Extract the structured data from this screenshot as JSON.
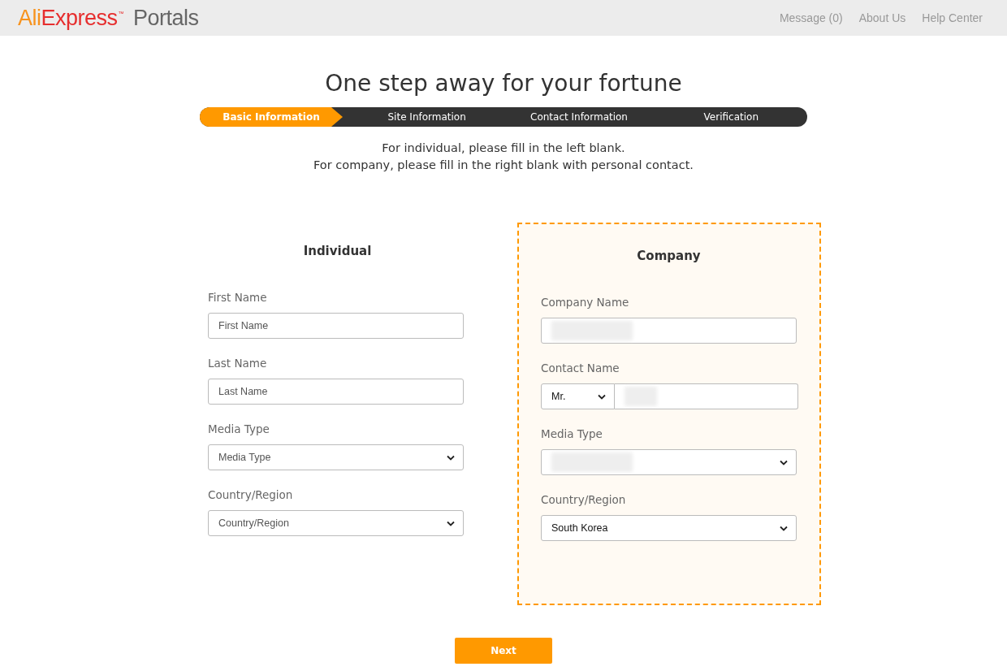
{
  "header": {
    "logo": {
      "part_1": "Ali",
      "part_2": "Express",
      "trademark": "™",
      "product": "Portals"
    },
    "links": [
      "Message (0)",
      "About Us",
      "Help Center"
    ]
  },
  "title": "One step away for your fortune",
  "steps": [
    {
      "label": "Basic Information",
      "selected": true
    },
    {
      "label": "Site Information",
      "selected": false
    },
    {
      "label": "Contact Information",
      "selected": false
    },
    {
      "label": "Verification",
      "selected": false
    }
  ],
  "instructions": [
    "For individual, please fill in the left blank.",
    "For company, please fill in the right blank with personal contact."
  ],
  "panels": [
    {
      "heading": "Individual",
      "kind": "plain",
      "fields": [
        {
          "label": "First Name",
          "kind": "text",
          "placeholder": "First Name"
        },
        {
          "label": "Last Name",
          "kind": "text",
          "placeholder": "Last Name"
        },
        {
          "label": "Media Type",
          "kind": "select",
          "placeholder": "Media Type"
        },
        {
          "label": "Country/Region",
          "kind": "select",
          "placeholder": "Country/Region"
        }
      ]
    },
    {
      "heading": "Company",
      "kind": "highlighted",
      "fields": [
        {
          "label": "Company Name",
          "kind": "text",
          "blurred": true
        },
        {
          "label": "Contact Name",
          "kind": "name",
          "salutation": "Mr.",
          "blurred": true
        },
        {
          "label": "Media Type",
          "kind": "select",
          "blurred": true
        },
        {
          "label": "Country/Region",
          "kind": "select",
          "value": "South Korea"
        }
      ]
    }
  ],
  "next_button": "Next"
}
